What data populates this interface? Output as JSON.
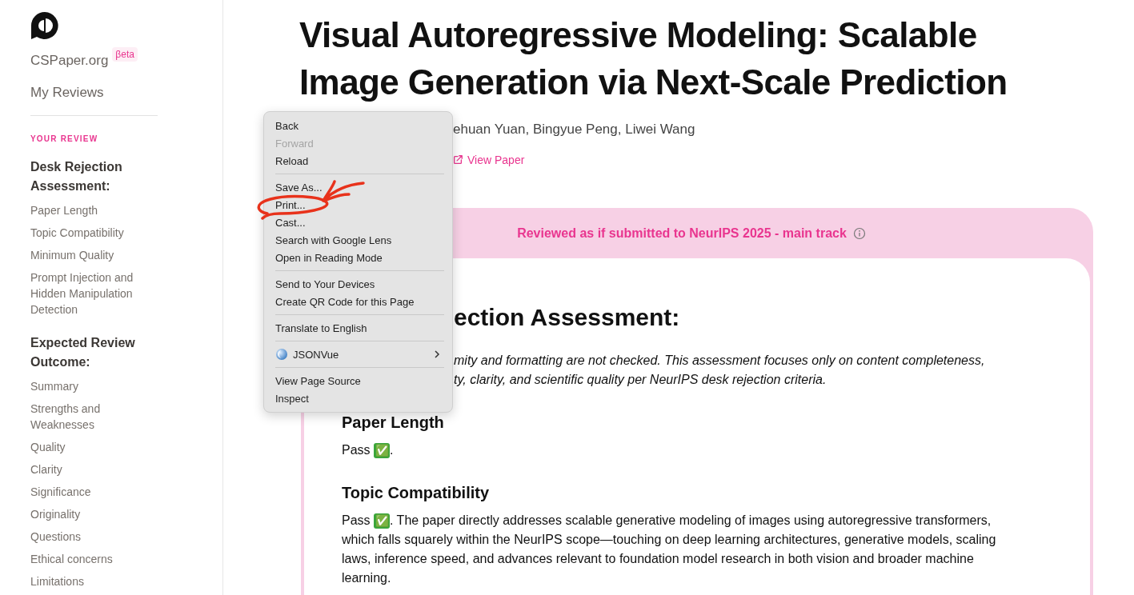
{
  "sidebar": {
    "brand": "CSPaper.org",
    "badge": "βeta",
    "nav_link": "My Reviews",
    "section_label": "YOUR REVIEW",
    "groups": [
      {
        "title": "Desk Rejection Assessment:",
        "items": [
          "Paper Length",
          "Topic Compatibility",
          "Minimum Quality",
          "Prompt Injection and Hidden Manipulation Detection"
        ]
      },
      {
        "title": "Expected Review Outcome:",
        "items": [
          "Summary",
          "Strengths and Weaknesses",
          "Quality",
          "Clarity",
          "Significance",
          "Originality",
          "Questions",
          "Ethical concerns",
          "Limitations"
        ]
      }
    ]
  },
  "paper": {
    "title": "Visual Autoregressive Modeling: Scalable Image Generation via Next-Scale Prediction",
    "authors": "ehuan Yuan, Bingyue Peng, Liwei Wang",
    "link": "View Paper"
  },
  "review": {
    "banner": "Reviewed as if submitted to NeurIPS 2025 - main track",
    "heading": "ection Assessment:",
    "note_lines": [
      "mity and formatting are not checked. This assessment focuses only on content completeness,",
      "ty, clarity, and scientific quality per NeurIPS desk rejection criteria."
    ],
    "sections": [
      {
        "title": "Paper Length",
        "verdict": "Pass",
        "mark": "✅",
        "text": "."
      },
      {
        "title": "Topic Compatibility",
        "verdict": "Pass",
        "mark": "✅",
        "text": ". The paper directly addresses scalable generative modeling of images using autoregressive transformers, which falls squarely within the NeurIPS scope—touching on deep learning architectures, generative models, scaling laws, inference speed, and advances relevant to foundation model research in both vision and broader machine learning."
      }
    ]
  },
  "context_menu": {
    "items": [
      {
        "kind": "item",
        "label": "Back",
        "disabled": false
      },
      {
        "kind": "item",
        "label": "Forward",
        "disabled": true
      },
      {
        "kind": "item",
        "label": "Reload",
        "disabled": false
      },
      {
        "kind": "separator"
      },
      {
        "kind": "item",
        "label": "Save As...",
        "disabled": false
      },
      {
        "kind": "item",
        "label": "Print...",
        "disabled": false
      },
      {
        "kind": "item",
        "label": "Cast...",
        "disabled": false
      },
      {
        "kind": "item",
        "label": "Search with Google Lens",
        "disabled": false
      },
      {
        "kind": "item",
        "label": "Open in Reading Mode",
        "disabled": false
      },
      {
        "kind": "separator"
      },
      {
        "kind": "item",
        "label": "Send to Your Devices",
        "disabled": false
      },
      {
        "kind": "item",
        "label": "Create QR Code for this Page",
        "disabled": false
      },
      {
        "kind": "separator"
      },
      {
        "kind": "item",
        "label": "Translate to English",
        "disabled": false
      },
      {
        "kind": "separator"
      },
      {
        "kind": "submenu",
        "label": "JSONVue",
        "disabled": false
      },
      {
        "kind": "separator"
      },
      {
        "kind": "item",
        "label": "View Page Source",
        "disabled": false
      },
      {
        "kind": "item",
        "label": "Inspect",
        "disabled": false
      }
    ]
  }
}
